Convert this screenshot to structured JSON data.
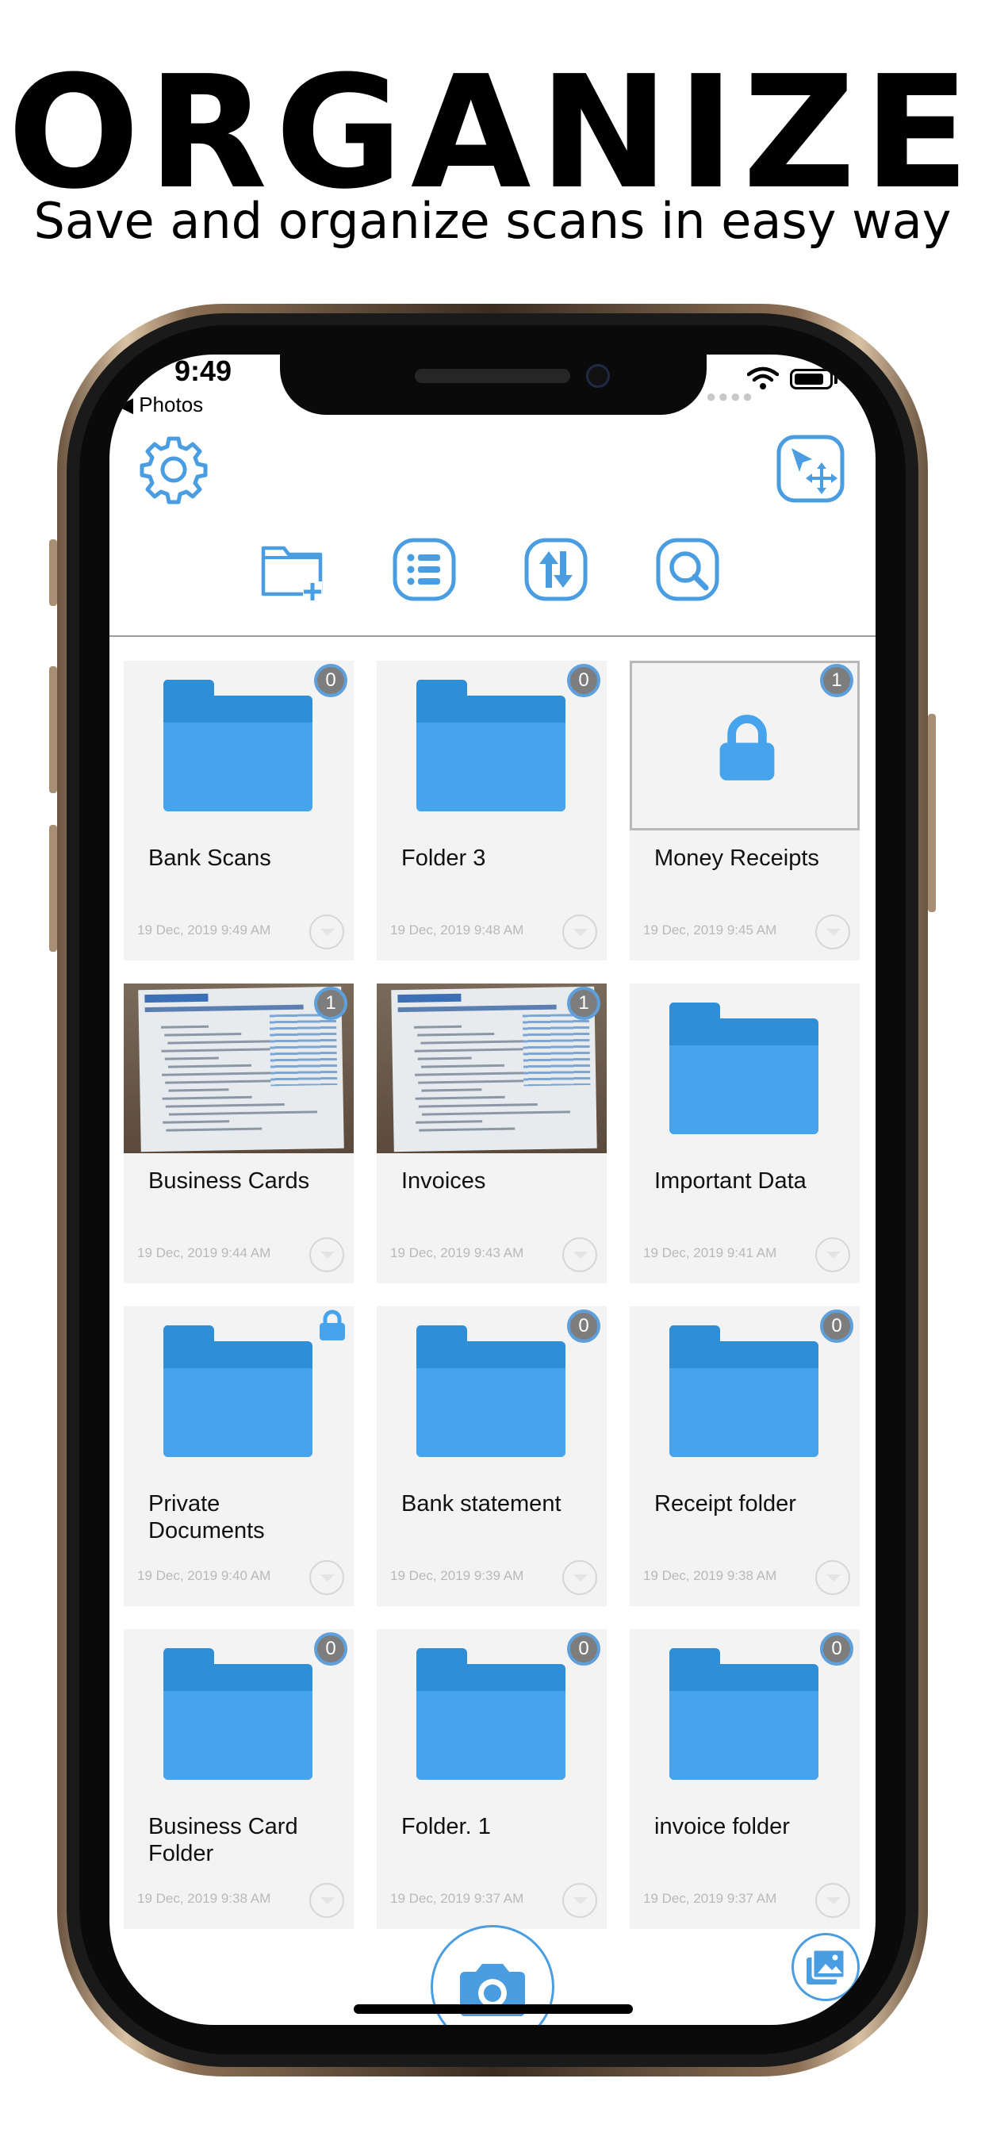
{
  "promo": {
    "headline": "ORGANIZE",
    "subline": "Save and organize scans in easy way"
  },
  "status_bar": {
    "time": "9:49",
    "back_label": "◀ Photos"
  },
  "toolbar": {
    "settings_icon": "gear-icon",
    "move_icon": "move-arrows-icon",
    "new_folder_icon": "new-folder-icon",
    "list_icon": "list-view-icon",
    "sort_icon": "sort-icon",
    "search_icon": "search-icon"
  },
  "folders": [
    {
      "name": "Bank Scans",
      "date": "19 Dec, 2019 9:49 AM",
      "badge": "0",
      "type": "folder"
    },
    {
      "name": "Folder 3",
      "date": "19 Dec, 2019 9:48 AM",
      "badge": "0",
      "type": "folder"
    },
    {
      "name": "Money Receipts",
      "date": "19 Dec, 2019 9:45 AM",
      "badge": "1",
      "type": "locked"
    },
    {
      "name": "Business Cards",
      "date": "19 Dec, 2019 9:44 AM",
      "badge": "1",
      "type": "document"
    },
    {
      "name": "Invoices",
      "date": "19 Dec, 2019 9:43 AM",
      "badge": "1",
      "type": "document"
    },
    {
      "name": "Important Data",
      "date": "19 Dec, 2019 9:41 AM",
      "badge": "",
      "type": "folder"
    },
    {
      "name": "Private Documents",
      "date": "19 Dec, 2019 9:40 AM",
      "badge": "lock",
      "type": "folder"
    },
    {
      "name": "Bank statement",
      "date": "19 Dec, 2019 9:39 AM",
      "badge": "0",
      "type": "folder"
    },
    {
      "name": "Receipt  folder",
      "date": "19 Dec, 2019 9:38 AM",
      "badge": "0",
      "type": "folder"
    },
    {
      "name": "Business Card Folder",
      "date": "19 Dec, 2019 9:38 AM",
      "badge": "0",
      "type": "folder"
    },
    {
      "name": "Folder. 1",
      "date": "19 Dec, 2019 9:37 AM",
      "badge": "0",
      "type": "folder"
    },
    {
      "name": "invoice folder",
      "date": "19 Dec, 2019 9:37 AM",
      "badge": "0",
      "type": "folder"
    }
  ],
  "bottom_bar": {
    "camera_icon": "camera-icon",
    "gallery_icon": "gallery-icon"
  },
  "colors": {
    "accent": "#4a9de0",
    "folder_front": "#45a4ec",
    "folder_back": "#2f8fd6",
    "card_bg": "#f3f3f3"
  }
}
